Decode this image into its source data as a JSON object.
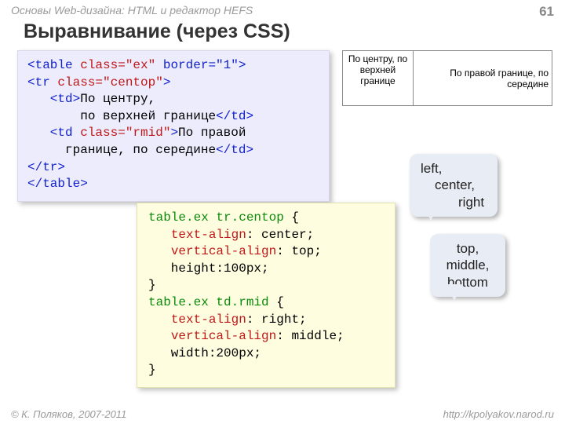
{
  "header": {
    "breadcrumb": "Основы Web-дизайна: HTML и редактор HEFS",
    "page": "61"
  },
  "title": "Выравнивание (через CSS)",
  "html_code": {
    "l1a": "<table ",
    "l1b": "class=\"ex\"",
    "l1c": " border=\"1\">",
    "l2a": "<tr ",
    "l2b": "class=\"centop\"",
    "l2c": ">",
    "l3a": "   <td>",
    "l3b": "По центру,",
    "l4": "       по верхней границе",
    "l4b": "</td>",
    "l5a": "   <td ",
    "l5b": "class=\"rmid\"",
    "l5c": ">",
    "l5d": "По правой",
    "l6": "     границе, по середине",
    "l6b": "</td>",
    "l7": "</tr>",
    "l8": "</table>"
  },
  "css_code": {
    "r1a": "table.ex tr.centop",
    "r1b": " {",
    "r2a": "   ",
    "r2p": "text-align",
    "r2b": ": center;",
    "r3a": "   ",
    "r3p": "vertical-align",
    "r3b": ": top;",
    "r4": "   height:100px;",
    "r5": "}",
    "r6a": "table.ex td.rmid",
    "r6b": " {",
    "r7a": "   ",
    "r7p": "text-align",
    "r7b": ": right;",
    "r8a": "   ",
    "r8p": "vertical-align",
    "r8b": ": middle;",
    "r9": "   width:200px;",
    "r10": "}"
  },
  "example": {
    "cell1": "По центру, по верхней границе",
    "cell2": "По правой границе, по середине"
  },
  "callouts": {
    "align": {
      "l1": "left,",
      "l2": "center,",
      "l3": "right"
    },
    "valign": {
      "l1": "top,",
      "l2": "middle,",
      "l3": "bottom"
    }
  },
  "footer": {
    "copyright": "© К. Поляков, 2007-2011",
    "url": "http://kpolyakov.narod.ru"
  }
}
